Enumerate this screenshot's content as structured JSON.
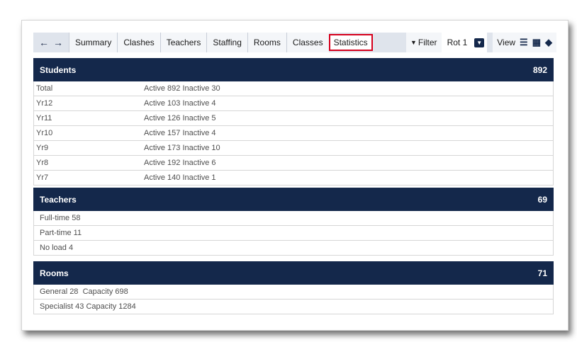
{
  "toolbar": {
    "back_icon": "arrow-left-icon",
    "forward_icon": "arrow-right-icon",
    "tabs": [
      "Summary",
      "Clashes",
      "Teachers",
      "Staffing",
      "Rooms",
      "Classes",
      "Statistics"
    ],
    "active_tab": "Statistics",
    "filter_label": "Filter",
    "rotation_value": "Rot 1",
    "view_label": "View"
  },
  "students": {
    "title": "Students",
    "total": "892",
    "rows": [
      {
        "label": "Total",
        "active": "Active 892",
        "inactive": "Inactive 30"
      },
      {
        "label": "Yr12",
        "active": "Active 103",
        "inactive": "Inactive 4"
      },
      {
        "label": "Yr11",
        "active": "Active 126",
        "inactive": "Inactive 5"
      },
      {
        "label": "Yr10",
        "active": "Active 157",
        "inactive": "Inactive 4"
      },
      {
        "label": "Yr9",
        "active": "Active 173",
        "inactive": "Inactive 10"
      },
      {
        "label": "Yr8",
        "active": "Active 192",
        "inactive": "Inactive 6"
      },
      {
        "label": "Yr7",
        "active": "Active 140",
        "inactive": "Inactive 1"
      }
    ]
  },
  "teachers": {
    "title": "Teachers",
    "total": "69",
    "rows": [
      "Full-time 58",
      "Part-time 11",
      "No load 4"
    ]
  },
  "rooms": {
    "title": "Rooms",
    "total": "71",
    "rows": [
      {
        "label": "General 28",
        "capacity": "Capacity 698"
      },
      {
        "label": "Specialist 43",
        "capacity": "Capacity 1284"
      }
    ]
  },
  "colors": {
    "header_bg": "#14284b",
    "active_tab_border": "#d6001c",
    "toolbar_bg": "#dfe4ec"
  }
}
